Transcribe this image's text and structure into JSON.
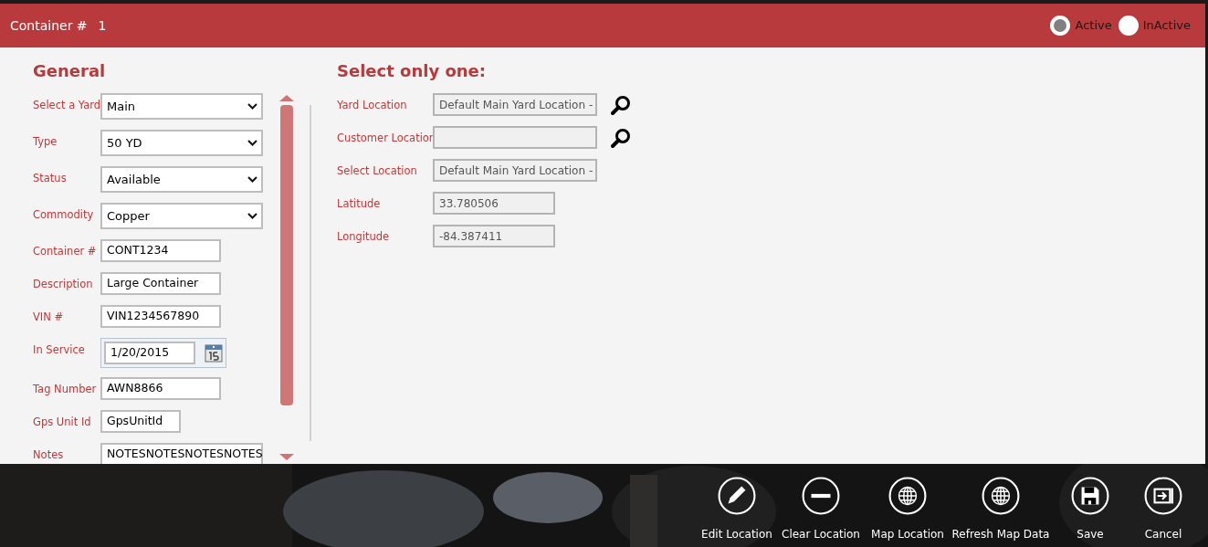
{
  "header": {
    "title": "Container #",
    "number": "1"
  },
  "status_options": [
    {
      "label": "Active",
      "selected": true
    },
    {
      "label": "InActive",
      "selected": false
    }
  ],
  "general": {
    "heading": "General",
    "fields": [
      {
        "label": "Select a Yard",
        "kind": "select",
        "value": "Main"
      },
      {
        "label": "Type",
        "kind": "select",
        "value": "50 YD"
      },
      {
        "label": "Status",
        "kind": "select",
        "value": "Available"
      },
      {
        "label": "Commodity",
        "kind": "select",
        "value": "Copper"
      },
      {
        "label": "Container #",
        "kind": "text",
        "value": "CONT1234"
      },
      {
        "label": "Description",
        "kind": "text",
        "value": "Large Container"
      },
      {
        "label": "VIN #",
        "kind": "text",
        "value": "VIN1234567890"
      },
      {
        "label": "In Service",
        "kind": "date",
        "value": "1/20/2015"
      },
      {
        "label": "Tag Number",
        "kind": "text",
        "value": "AWN8866"
      },
      {
        "label": "Gps Unit Id",
        "kind": "text",
        "value": "GpsUnitId"
      },
      {
        "label": "Notes",
        "kind": "text",
        "value": "NOTESNOTESNOTESNOTES"
      }
    ]
  },
  "location": {
    "heading": "Select only one:",
    "fields": [
      {
        "label": "Yard Location",
        "value": "Default Main Yard Location -",
        "search": true
      },
      {
        "label": "Customer Location",
        "search": true
      },
      {
        "label": "Select Location",
        "value": "Default Main Yard Location -",
        "search": false
      },
      {
        "label": "Latitude",
        "value": "33.780506",
        "search": false
      },
      {
        "label": "Longitude",
        "value": "-84.387411",
        "search": false
      }
    ]
  },
  "actions": [
    {
      "label": "Edit Location"
    },
    {
      "label": "Clear Location"
    },
    {
      "label": "Map Location"
    },
    {
      "label": "Refresh Map Data"
    },
    {
      "label": "Save"
    },
    {
      "label": "Cancel"
    }
  ]
}
